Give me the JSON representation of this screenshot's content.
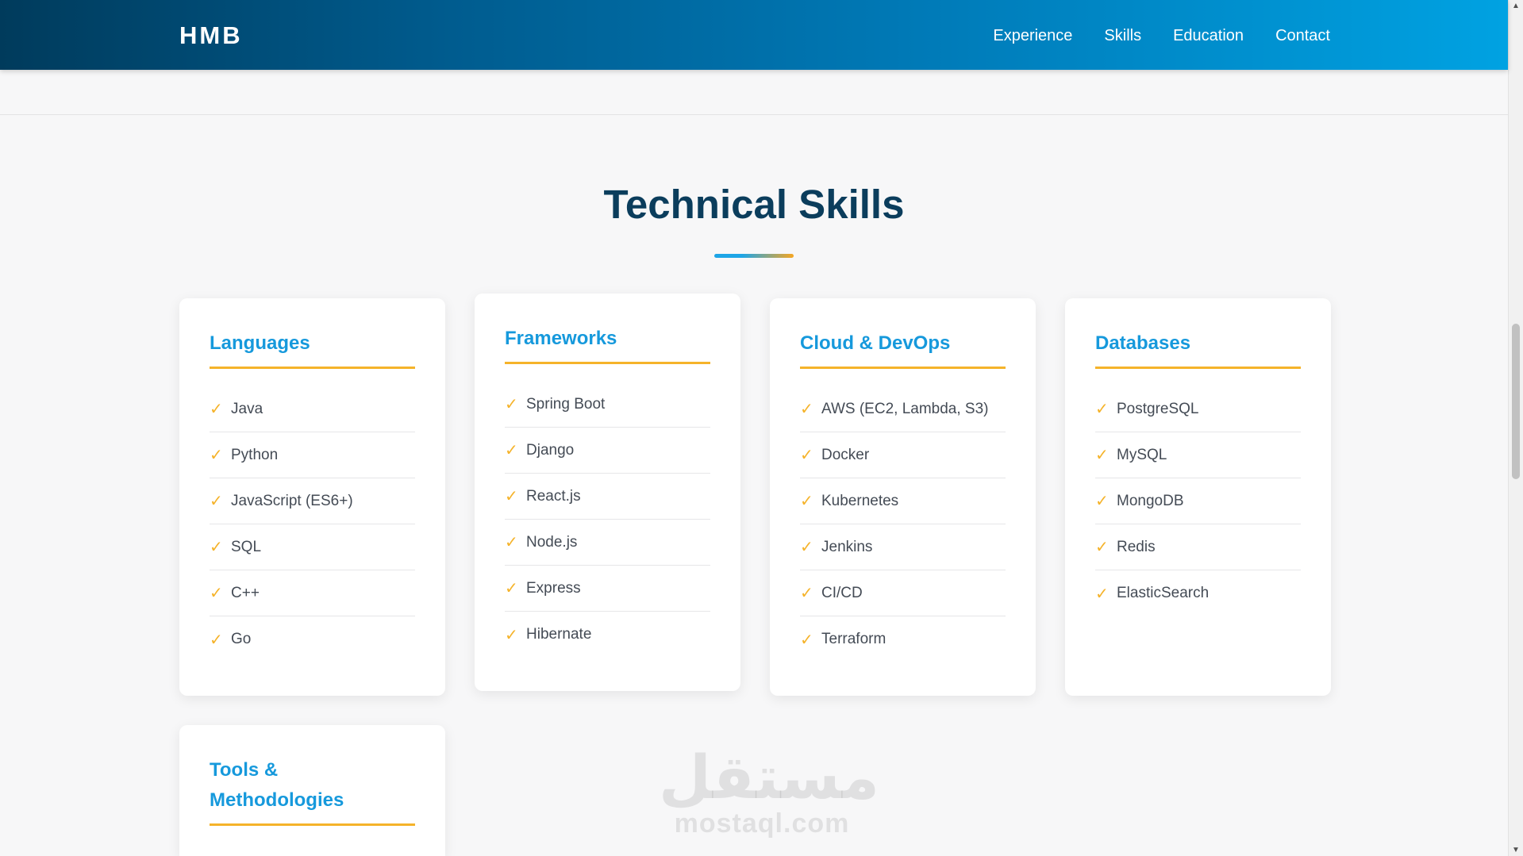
{
  "nav": {
    "brand": "HMB",
    "links": [
      "Experience",
      "Skills",
      "Education",
      "Contact"
    ]
  },
  "skills_section": {
    "title": "Technical Skills",
    "cards": [
      {
        "title": "Languages",
        "items": [
          "Java",
          "Python",
          "JavaScript (ES6+)",
          "SQL",
          "C++",
          "Go"
        ]
      },
      {
        "title": "Frameworks",
        "items": [
          "Spring Boot",
          "Django",
          "React.js",
          "Node.js",
          "Express",
          "Hibernate"
        ]
      },
      {
        "title": "Cloud & DevOps",
        "items": [
          "AWS (EC2, Lambda, S3)",
          "Docker",
          "Kubernetes",
          "Jenkins",
          "CI/CD",
          "Terraform"
        ]
      },
      {
        "title": "Databases",
        "items": [
          "PostgreSQL",
          "MySQL",
          "MongoDB",
          "Redis",
          "ElasticSearch"
        ]
      },
      {
        "title": "Tools & Methodologies",
        "items": []
      }
    ],
    "check_glyph": "✓"
  },
  "watermark": {
    "arabic": "مستقل",
    "latin": "mostaql.com"
  },
  "colors": {
    "nav_gradient_start": "#003b5c",
    "nav_gradient_end": "#00a2e2",
    "title": "#0b3d5c",
    "card_title": "#1699dc",
    "accent": "#f5b32a"
  }
}
